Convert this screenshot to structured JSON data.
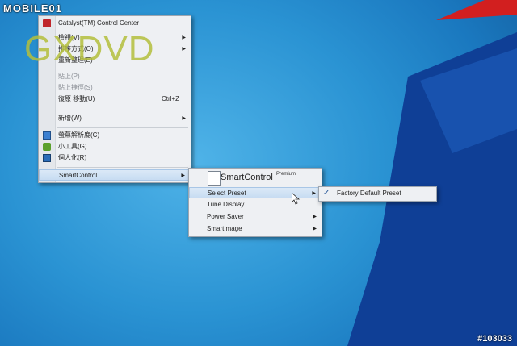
{
  "watermark": {
    "brand": "MOBILE01",
    "photo_id": "#103033"
  },
  "overlay_logo": "GXDVD",
  "desktop": {
    "colors": {
      "sky": "#2a93d3",
      "dark": "#0e3a8a",
      "red": "#d21f1f"
    }
  },
  "context_menu": {
    "items": [
      {
        "label": "Catalyst(TM) Control Center",
        "icon": "catalyst-icon"
      },
      {
        "label": "檢視(V)",
        "submenu": true
      },
      {
        "label": "排序方式(O)",
        "submenu": true
      },
      {
        "label": "重新整理(E)"
      },
      {
        "label": "貼上(P)",
        "disabled": true
      },
      {
        "label": "貼上捷徑(S)",
        "disabled": true
      },
      {
        "label": "復原 移動(U)",
        "shortcut": "Ctrl+Z"
      },
      {
        "label": "新增(W)",
        "submenu": true
      },
      {
        "label": "螢幕解析度(C)",
        "icon": "display-icon"
      },
      {
        "label": "小工具(G)",
        "icon": "gadget-icon"
      },
      {
        "label": "個人化(R)",
        "icon": "personalize-icon"
      },
      {
        "label": "SmartControl",
        "submenu": true
      }
    ]
  },
  "smartcontrol_menu": {
    "brand": "SmartControl",
    "edition": "Premium",
    "items": [
      {
        "label": "Select Preset",
        "submenu": true,
        "highlighted": true
      },
      {
        "label": "Tune Display"
      },
      {
        "label": "Power Saver",
        "submenu": true
      },
      {
        "label": "SmartImage",
        "submenu": true
      }
    ]
  },
  "preset_submenu": {
    "items": [
      {
        "label": "Factory Default Preset",
        "checked": true
      }
    ]
  }
}
